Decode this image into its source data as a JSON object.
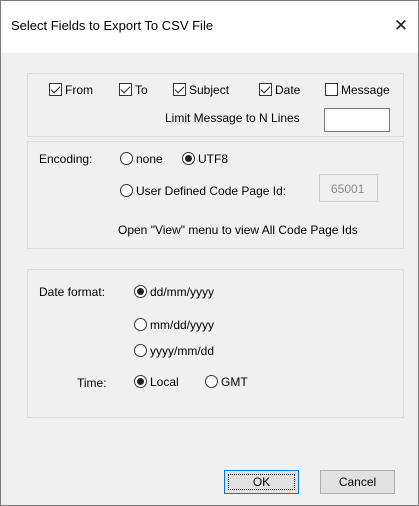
{
  "window": {
    "title": "Select Fields to Export To CSV File",
    "close_glyph": "✕"
  },
  "fields": {
    "items": [
      {
        "label": "From",
        "checked": true
      },
      {
        "label": "To",
        "checked": true
      },
      {
        "label": "Subject",
        "checked": true
      },
      {
        "label": "Date",
        "checked": true
      },
      {
        "label": "Message",
        "checked": false
      }
    ],
    "limit_label": "Limit Message to N Lines",
    "limit_value": ""
  },
  "encoding": {
    "label": "Encoding:",
    "options": [
      {
        "label": "none",
        "selected": false
      },
      {
        "label": "UTF8",
        "selected": true
      },
      {
        "label": "User Defined Code Page Id:",
        "selected": false
      }
    ],
    "code_page_value": "65001",
    "hint": "Open \"View\" menu to view All  Code Page Ids"
  },
  "date": {
    "label": "Date format:",
    "formats": [
      {
        "label": "dd/mm/yyyy",
        "selected": true
      },
      {
        "label": "mm/dd/yyyy",
        "selected": false
      },
      {
        "label": "yyyy/mm/dd",
        "selected": false
      }
    ],
    "time_label": "Time:",
    "time_options": [
      {
        "label": "Local",
        "selected": true
      },
      {
        "label": "GMT",
        "selected": false
      }
    ]
  },
  "buttons": {
    "ok": "OK",
    "cancel": "Cancel"
  },
  "colors": {
    "dialog_bg": "#f0f0f0",
    "focus_border": "#0078d7"
  }
}
